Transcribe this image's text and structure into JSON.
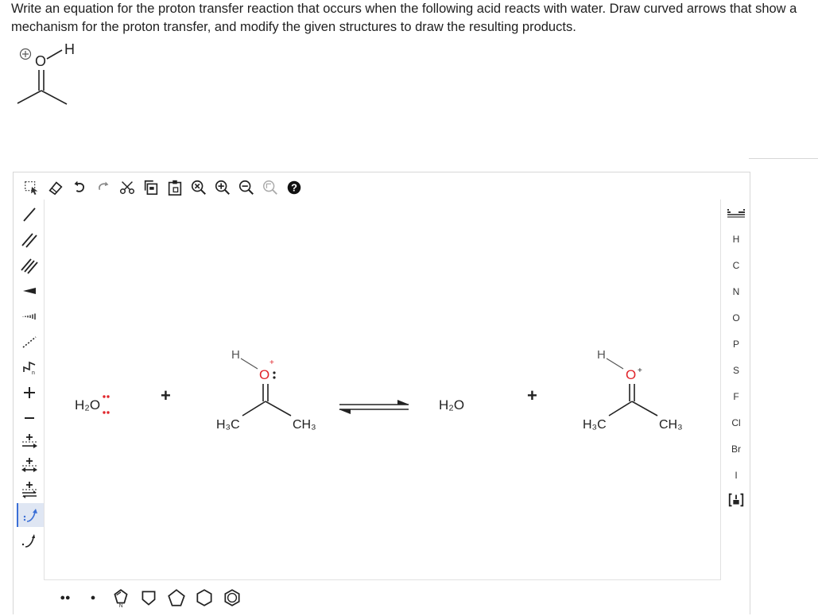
{
  "question": {
    "text": "Write an equation for the proton transfer reaction that occurs when the following acid reacts with water. Draw curved arrows that show a mechanism for the proton transfer, and modify the given structures to draw the resulting products."
  },
  "given_structure": {
    "charge": "⊕",
    "oxygen": "O",
    "hydrogen": "H"
  },
  "toolbar_top": [
    {
      "name": "select-tool",
      "icon": "lasso-select-icon"
    },
    {
      "name": "erase-tool",
      "icon": "eraser-icon"
    },
    {
      "name": "undo-button",
      "icon": "undo-icon"
    },
    {
      "name": "redo-button",
      "icon": "redo-icon"
    },
    {
      "name": "cut-button",
      "icon": "scissors-icon"
    },
    {
      "name": "copy-button",
      "icon": "copy-icon"
    },
    {
      "name": "paste-button",
      "icon": "paste-icon"
    },
    {
      "name": "clear-button",
      "icon": "clear-canvas-icon"
    },
    {
      "name": "zoom-in-button",
      "icon": "zoom-in-icon"
    },
    {
      "name": "zoom-out-button",
      "icon": "zoom-out-icon"
    },
    {
      "name": "zoom-fit-button",
      "icon": "zoom-fit-icon"
    },
    {
      "name": "help-button",
      "icon": "help-icon"
    }
  ],
  "toolbar_left": [
    {
      "name": "single-bond-tool"
    },
    {
      "name": "double-bond-tool"
    },
    {
      "name": "triple-bond-tool"
    },
    {
      "name": "wedge-bond-tool"
    },
    {
      "name": "hash-bond-tool"
    },
    {
      "name": "wavy-bond-tool"
    },
    {
      "name": "chain-tool"
    },
    {
      "name": "positive-charge-tool"
    },
    {
      "name": "negative-charge-tool"
    },
    {
      "name": "reaction-arrow-tool"
    },
    {
      "name": "resonance-arrow-tool"
    },
    {
      "name": "equilibrium-arrow-tool"
    },
    {
      "name": "electron-pair-arrow-tool",
      "selected": true
    },
    {
      "name": "single-electron-arrow-tool"
    }
  ],
  "toolbar_right": {
    "periodic_table_icon": "periodic-table-icon",
    "elements": [
      "H",
      "C",
      "N",
      "O",
      "P",
      "S",
      "F",
      "Cl",
      "Br",
      "I"
    ],
    "template_icon": "bracket-template-icon"
  },
  "toolbar_bottom": [
    {
      "name": "lone-pair-tool"
    },
    {
      "name": "radical-tool"
    },
    {
      "name": "pyrrole-template"
    },
    {
      "name": "cyclobutane-template"
    },
    {
      "name": "cyclopentane-template"
    },
    {
      "name": "cyclohexane-template"
    },
    {
      "name": "benzene-template"
    }
  ],
  "reaction": {
    "reactant_water": {
      "label": "H₂O",
      "lone_pairs": 2
    },
    "plus_1": "+",
    "reactant_acetone": {
      "oxygen": "O",
      "h_label": "H",
      "methyl_left": "H₃C",
      "methyl_right": "CH₃",
      "charge": "+"
    },
    "arrow_type": "equilibrium",
    "product_water": {
      "label": "H₂O"
    },
    "plus_2": "+",
    "product_protonated_acetone": {
      "oxygen": "O",
      "h_label": "H",
      "methyl_left": "H₃C",
      "methyl_right": "CH₃",
      "charge": "+"
    }
  },
  "colors": {
    "oxygen": "#e0242a",
    "lone_pair": "#e0242a",
    "bond": "#222222",
    "selected_tool_bg": "#dfe6f3",
    "accent_blue": "#3b6fd6"
  }
}
